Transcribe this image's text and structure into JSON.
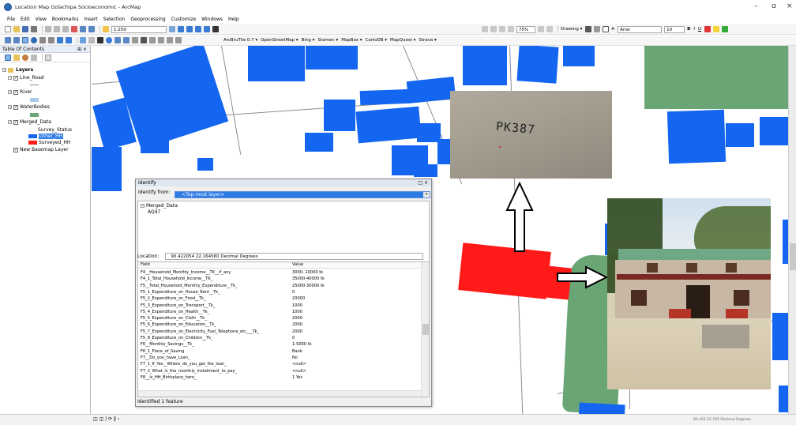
{
  "window": {
    "title": "Location Map Golachipa Socioeconomic - ArcMap",
    "minimize": "–",
    "restore": "ɑ",
    "close": "×"
  },
  "menubar": [
    "File",
    "Edit",
    "View",
    "Bookmarks",
    "Insert",
    "Selection",
    "Geoprocessing",
    "Customize",
    "Windows",
    "Help"
  ],
  "toolbar": {
    "scale": "1:250",
    "basemaps": [
      "ArcBruTile 0.7 ▾",
      "OpenStreetMap ▾",
      "Bing ▾",
      "Stamen ▾",
      "MapBox ▾",
      "CartoDB ▾",
      "MapQuest ▾",
      "Strava ▾"
    ],
    "zoom_pct": "75%",
    "drawing_label": "Drawing ▾",
    "font_name": "Arial",
    "font_size": "10",
    "bold": "B",
    "italic": "I",
    "underline": "U",
    "font_color": "A"
  },
  "toc": {
    "title": "Table Of Contents",
    "pin": "⊞ ×",
    "root": "Layers",
    "layers": [
      {
        "label": "Line_Road",
        "checked": true
      },
      {
        "label": "River",
        "checked": true
      },
      {
        "label": "WaterBodies",
        "checked": true
      },
      {
        "label": "Merged_Data",
        "checked": true
      },
      {
        "label": "New Basemap Layer",
        "checked": true
      }
    ],
    "field_name": "Survey_Status",
    "legend": [
      {
        "label": "Other_HH",
        "color": "#1466f0",
        "selected": true
      },
      {
        "label": "Surveyed_HH",
        "color": "#ff1a1a",
        "selected": false
      }
    ]
  },
  "identify": {
    "title": "Identify",
    "close_controls": "□ ×",
    "from_label": "Identify from:",
    "from_value": "<Top-most layer>",
    "tree_root": "Merged_Data",
    "tree_child": "AQ47",
    "location_label": "Location:",
    "location_value": "90.422054  22.164560 Decimal Degrees",
    "col_field": "Field",
    "col_value": "Value",
    "rows": [
      {
        "f": "F4__Household_Monthly_Income__TK__if_any",
        "v": "3000- 10000 tk"
      },
      {
        "f": "F4_1_Total_Household_Income__TK_",
        "v": "35000-40000 tk"
      },
      {
        "f": "F5__Total_Household_Monthly_Expenditure__Tk_",
        "v": "25000-30000 tk"
      },
      {
        "f": "F5_1_Expenditure_on_House_Rent__Tk_",
        "v": "0"
      },
      {
        "f": "F5_2_Expenditure_on_Food__Tk_",
        "v": "20000"
      },
      {
        "f": "F5_3_Expenditure_on_Transport__Tk_",
        "v": "1000"
      },
      {
        "f": "F5_4_Expenditure_on_Health__Tk_",
        "v": "1000"
      },
      {
        "f": "F5_5_Expenditure_on_Cloth__Tk_",
        "v": "2000"
      },
      {
        "f": "F5_6_Expenditure_on_Education__Tk_",
        "v": "2000"
      },
      {
        "f": "F5_7_Expenditure_on_Electricity_Fuel_Telephone_etc___Tk_",
        "v": "2000"
      },
      {
        "f": "F5_8_Expenditure_on_Children__Tk_",
        "v": "0"
      },
      {
        "f": "F6__Monthly_Savings__Tk_",
        "v": "1-5000 tk"
      },
      {
        "f": "F6_1_Place_of_Saving",
        "v": "Bank"
      },
      {
        "f": "F7__Do_you_have_Loan_",
        "v": "No"
      },
      {
        "f": "F7_1_If_Yes__Where_do_you_get_the_loan_",
        "v": "<null>"
      },
      {
        "f": "F7_2_What_is_the_monthly_installment_to_pay_",
        "v": "<null>"
      },
      {
        "f": "F8__Is_HH_Birthplace_here_",
        "v": "1 Yes"
      }
    ],
    "status": "Identified 1 feature"
  },
  "photo_label": "PK387",
  "statusbar": {
    "page_controls": "◫ ◫ | ⟳ ‖ ‹",
    "coords": "90.422  22.165 Decimal Degrees"
  },
  "colors": {
    "building": "#1466f0",
    "surveyed": "#ff1a1a",
    "water": "#6aa575",
    "selection": "#2d7be5"
  }
}
